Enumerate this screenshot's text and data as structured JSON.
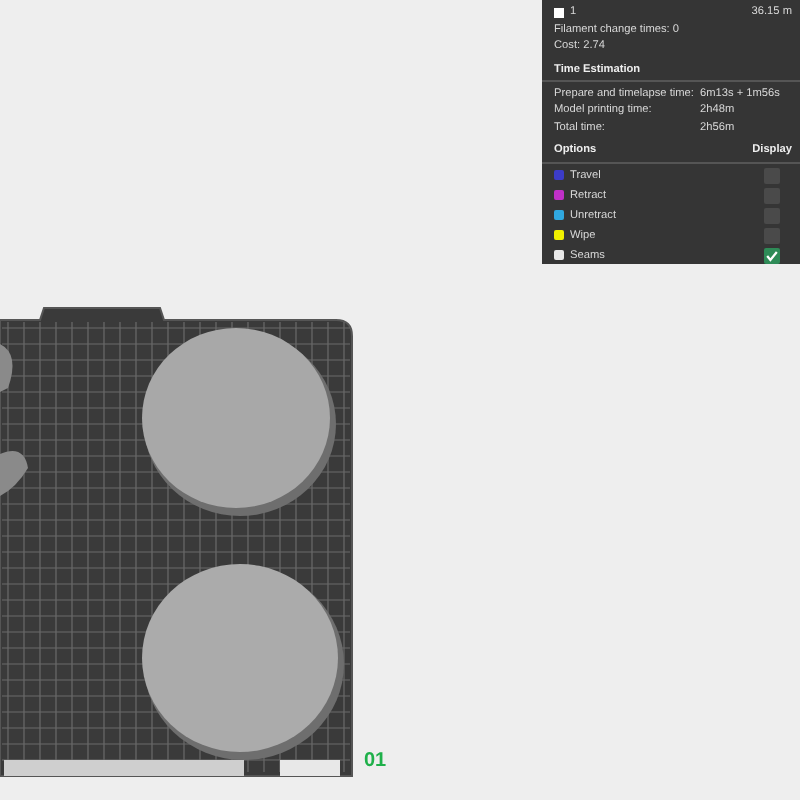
{
  "legend": {
    "filament": {
      "index": "1",
      "color": "#ffffff",
      "length": "36.15 m"
    },
    "filament_change_times": "Filament change times:  0",
    "cost": "Cost:  2.74",
    "time_estimation": {
      "title": "Time Estimation",
      "rows": [
        {
          "label": "Prepare and timelapse time:",
          "value": "6m13s + 1m56s"
        },
        {
          "label": "Model printing time:",
          "value": "2h48m"
        },
        {
          "label": "Total time:",
          "value": "2h56m"
        }
      ]
    },
    "options": {
      "header": "Options",
      "display_header": "Display",
      "items": [
        {
          "label": "Travel",
          "color": "#3c3cc8",
          "checked": false
        },
        {
          "label": "Retract",
          "color": "#c030c8",
          "checked": false
        },
        {
          "label": "Unretract",
          "color": "#30a8e0",
          "checked": false
        },
        {
          "label": "Wipe",
          "color": "#f0f000",
          "checked": false
        },
        {
          "label": "Seams",
          "color": "#e8e8e8",
          "checked": true
        }
      ]
    }
  },
  "viewport": {
    "kind": "picture",
    "plate_number": "01"
  }
}
